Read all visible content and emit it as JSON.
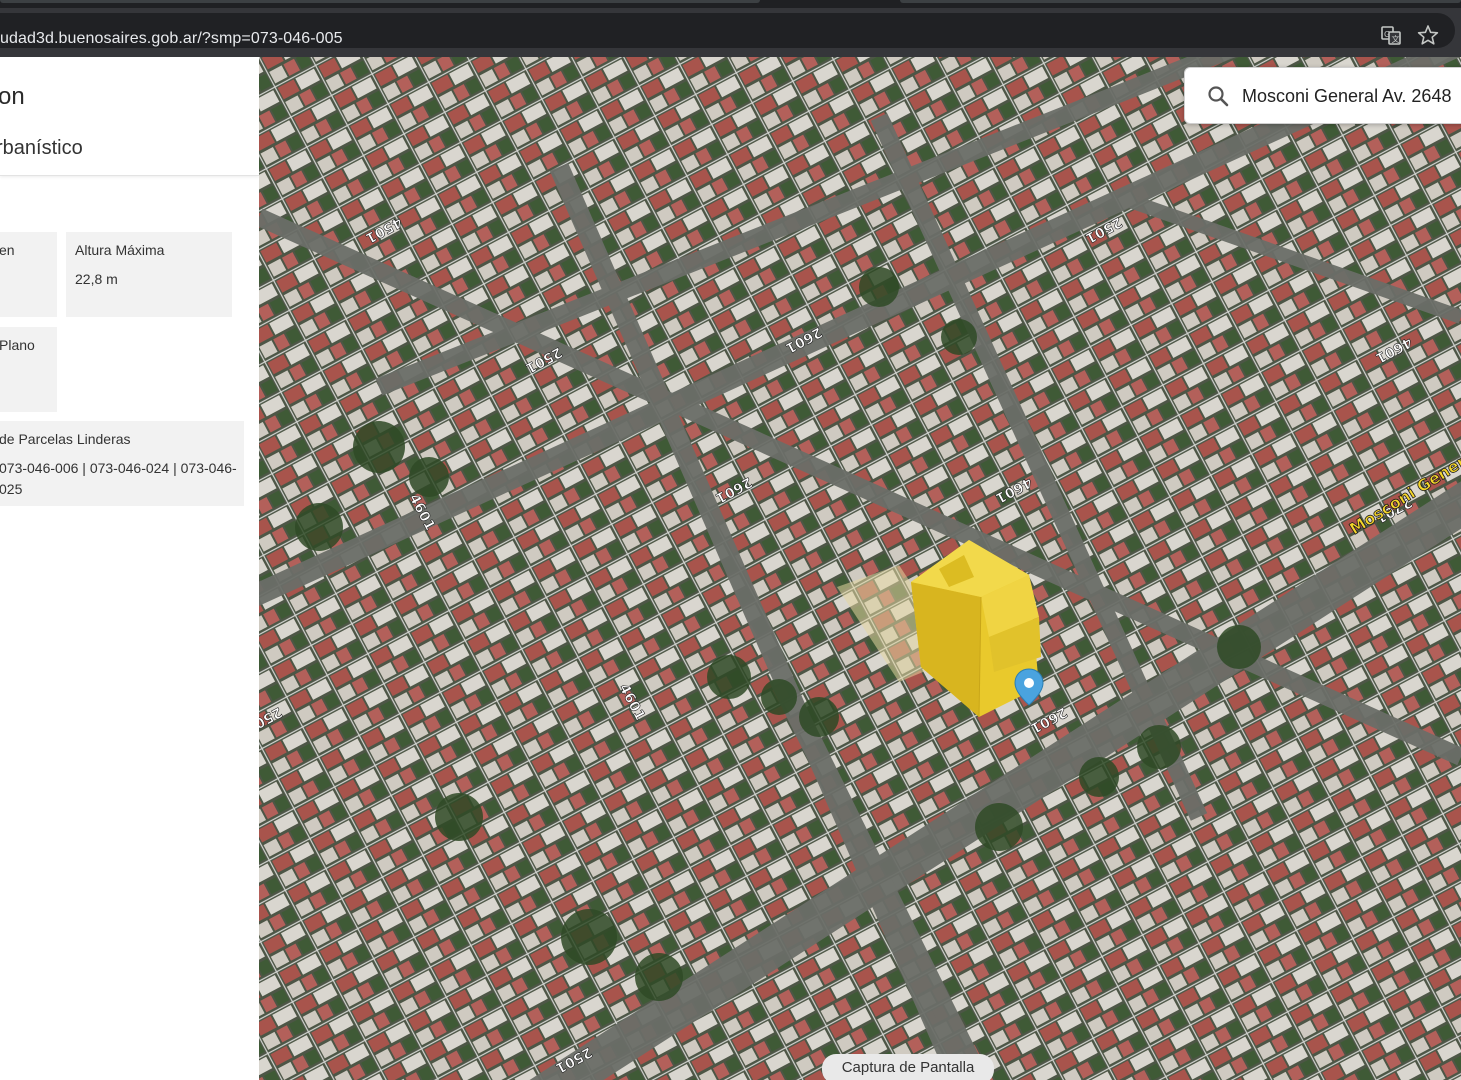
{
  "browser": {
    "url": "udad3d.buenosaires.gob.ar/?smp=073-046-005",
    "translate_icon": "translate-icon",
    "bookmark_icon": "star-icon"
  },
  "panel": {
    "title": "on",
    "subtitle": "rbanístico",
    "cards": [
      {
        "label": "en",
        "value": ""
      },
      {
        "label": "Altura Máxima",
        "value": "22,8 m"
      },
      {
        "label": "Plano",
        "value": ""
      },
      {
        "label": "de Parcelas Linderas",
        "value": "073-046-006 | 073-046-024 | 073-046-\n025"
      }
    ]
  },
  "search": {
    "value": "Mosconi General Av. 2648",
    "icon": "search-icon"
  },
  "map": {
    "street_labels": [
      "2501",
      "2501",
      "2601",
      "2601",
      "4601",
      "4601",
      "4601",
      "2501",
      "2701",
      "4501",
      "2601",
      "2501",
      "4601"
    ],
    "avenue_label": "Mosconi General Av.",
    "marker_icon": "location-pin-icon",
    "building_color": "#e9c92c",
    "capture_button": "Captura de Pantalla"
  }
}
